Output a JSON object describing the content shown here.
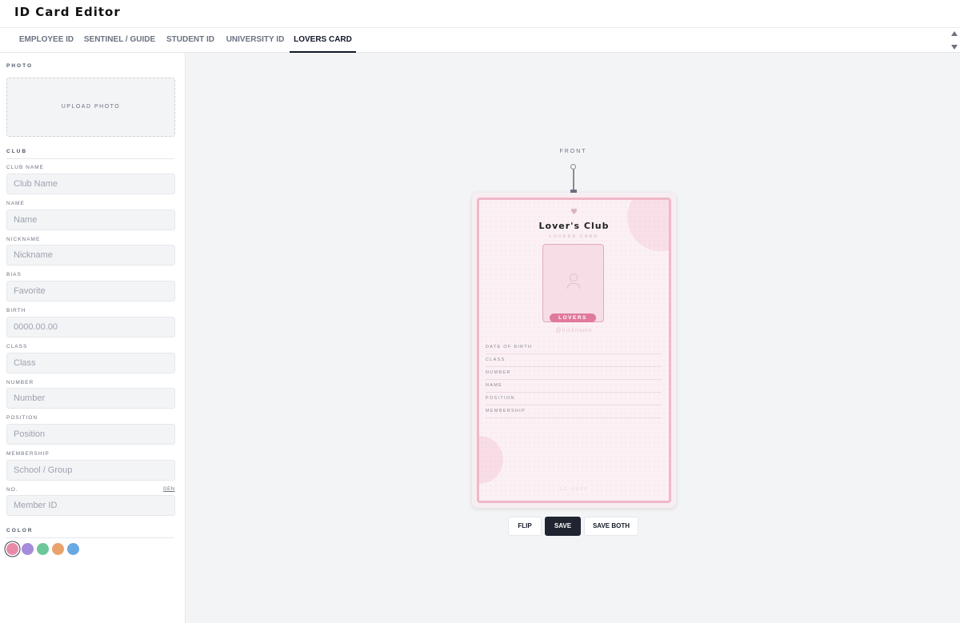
{
  "app": {
    "title": "ID Card Editor"
  },
  "tabs": [
    {
      "label": "EMPLOYEE ID",
      "active": false
    },
    {
      "label": "SENTINEL / GUIDE",
      "active": false
    },
    {
      "label": "STUDENT ID",
      "active": false
    },
    {
      "label": "UNIVERSITY ID",
      "active": false
    },
    {
      "label": "LOVERS CARD",
      "active": true
    }
  ],
  "sidebar": {
    "photo_section": "PHOTO",
    "upload_label": "UPLOAD PHOTO",
    "club_section": "CLUB",
    "fields": [
      {
        "label": "CLUB NAME",
        "placeholder": "Club Name",
        "value": ""
      },
      {
        "label": "NAME",
        "placeholder": "Name",
        "value": ""
      },
      {
        "label": "NICKNAME",
        "placeholder": "Nickname",
        "value": ""
      },
      {
        "label": "BIAS",
        "placeholder": "Favorite",
        "value": ""
      },
      {
        "label": "BIRTH",
        "placeholder": "0000.00.00",
        "value": ""
      },
      {
        "label": "CLASS",
        "placeholder": "Class",
        "value": ""
      },
      {
        "label": "NUMBER",
        "placeholder": "Number",
        "value": ""
      },
      {
        "label": "POSITION",
        "placeholder": "Position",
        "value": ""
      },
      {
        "label": "MEMBERSHIP",
        "placeholder": "School / Group",
        "value": ""
      },
      {
        "label": "NO.",
        "placeholder": "Member ID",
        "value": ""
      }
    ],
    "gen_label": "GEN",
    "color_section": "COLOR",
    "colors": [
      {
        "name": "pink",
        "hex": "#e889a8",
        "selected": true
      },
      {
        "name": "purple",
        "hex": "#a78bdb",
        "selected": false
      },
      {
        "name": "green",
        "hex": "#6cc79a",
        "selected": false
      },
      {
        "name": "orange",
        "hex": "#e9a26a",
        "selected": false
      },
      {
        "name": "blue",
        "hex": "#6aa8e2",
        "selected": false
      }
    ]
  },
  "preview": {
    "side_label": "FRONT",
    "card": {
      "heart_icon": "heart-icon",
      "title": "Lover's Club",
      "subtitle": "LOVERS CARD",
      "photo_icon": "user-icon",
      "badge": "LOVERS",
      "nickname": "@nickname",
      "rows": [
        "DATE OF BIRTH",
        "CLASS",
        "NUMBER",
        "NAME",
        "POSITION",
        "MEMBERSHIP"
      ],
      "number": "LC-0000",
      "accent": "#e07a9c",
      "frame_color": "#f0b8c8"
    }
  },
  "actions": {
    "flip": "FLIP",
    "save": "SAVE",
    "save_both": "SAVE BOTH"
  }
}
